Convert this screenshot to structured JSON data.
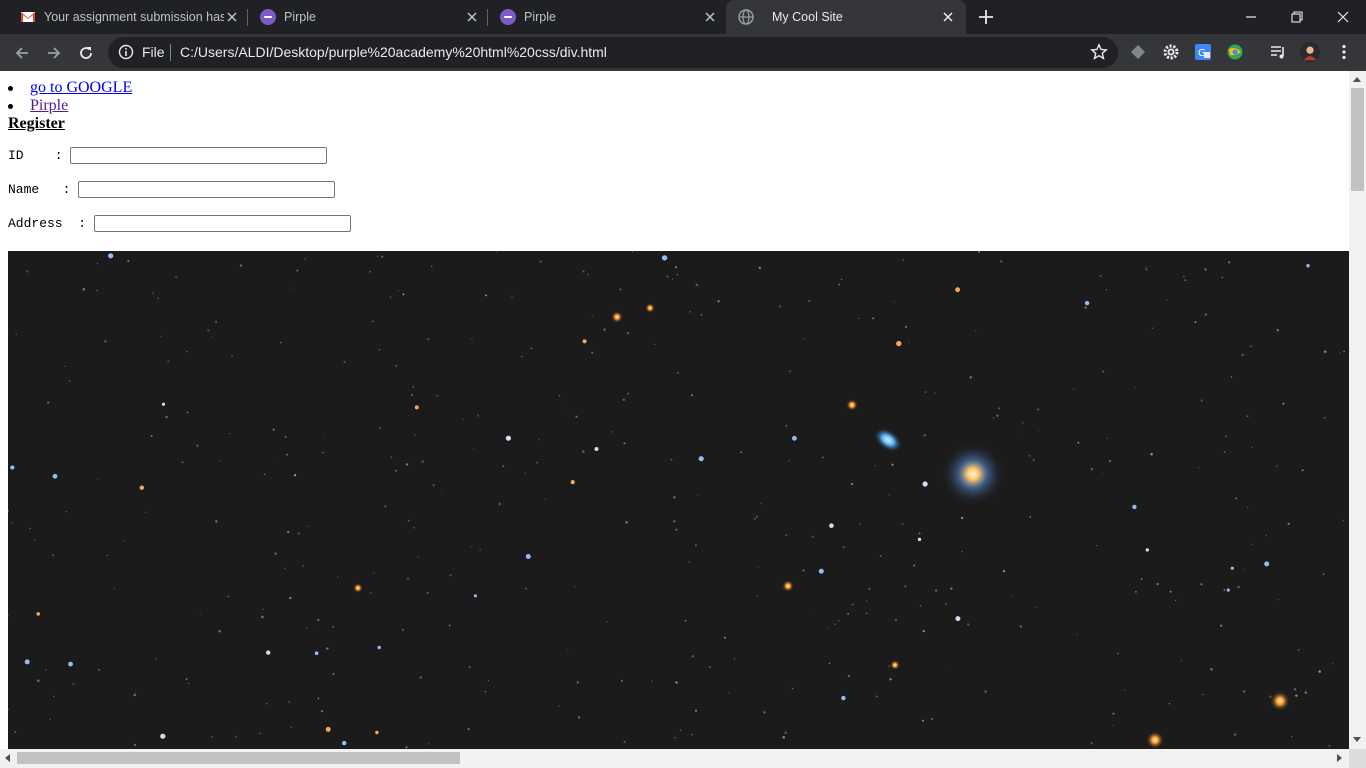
{
  "browser": {
    "tabs": [
      {
        "title": "Your assignment submission has",
        "icon": "gmail-icon",
        "active": false
      },
      {
        "title": "Pirple",
        "icon": "pirple-icon",
        "active": false
      },
      {
        "title": "Pirple",
        "icon": "pirple-icon",
        "active": false
      },
      {
        "title": "My Cool Site",
        "icon": "globe-icon",
        "active": true
      }
    ],
    "omnibox": {
      "scheme_label": "File",
      "url": "C:/Users/ALDI/Desktop/purple%20academy%20html%20css/div.html"
    },
    "extensions": [
      "layers-icon",
      "gear-icon",
      "translate-icon",
      "globe-extension-icon",
      "media-queue-icon",
      "profile-avatar",
      "menu-icon"
    ],
    "colors": {
      "frame": "#202124",
      "toolbar": "#35363a",
      "active_tab": "#35363a"
    }
  },
  "page": {
    "links": [
      {
        "label": "go to GOOGLE",
        "visited": false
      },
      {
        "label": "Pirple",
        "visited": true
      }
    ],
    "form": {
      "heading": "Register",
      "fields": [
        {
          "label": "ID    :",
          "value": ""
        },
        {
          "label": "Name   :",
          "value": ""
        },
        {
          "label": "Address  :",
          "value": ""
        }
      ]
    },
    "image": {
      "subject": "star field with galaxy",
      "colors": {
        "background": "#1b1b1c"
      }
    }
  }
}
